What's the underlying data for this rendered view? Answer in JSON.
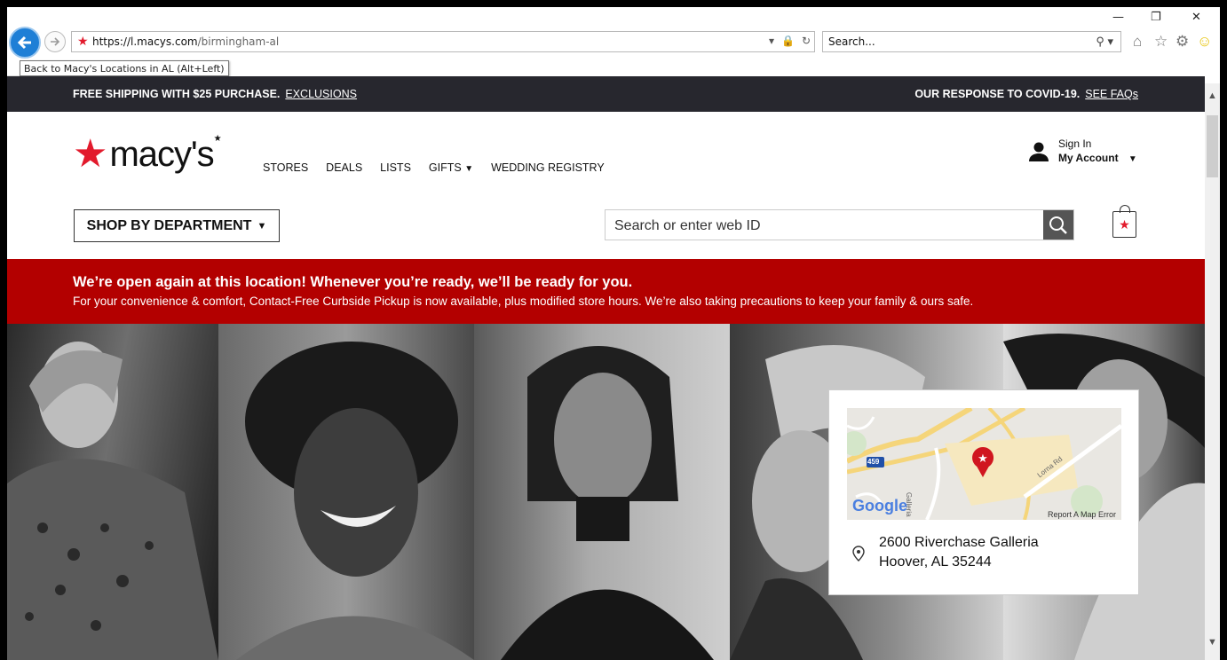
{
  "browser": {
    "url_host": "https://l.macys.com",
    "url_path": "/birmingham-al",
    "search_placeholder": "Search...",
    "tooltip": "Back to Macy's Locations in AL (Alt+Left)"
  },
  "promo": {
    "left_text": "FREE SHIPPING WITH $25 PURCHASE.",
    "left_link": "EXCLUSIONS",
    "right_text": "OUR RESPONSE TO COVID-19.",
    "right_link": "SEE FAQs"
  },
  "header": {
    "logo": "macy's",
    "nav": [
      "STORES",
      "DEALS",
      "LISTS",
      "GIFTS",
      "WEDDING REGISTRY"
    ],
    "sign_in": "Sign In",
    "my_account": "My Account",
    "shop_by_department": "SHOP BY DEPARTMENT",
    "search_placeholder": "Search or enter web ID"
  },
  "banner": {
    "headline": "We’re open again at this location! Whenever you’re ready, we’ll be ready for you.",
    "body": "For your convenience & comfort, Contact-Free Curbside Pickup is now available, plus modified store hours. We’re also taking precautions to keep your family & ours safe."
  },
  "map": {
    "labels": [
      "459",
      "Galleria",
      "Lorna Rd"
    ],
    "google": "Google",
    "report": "Report A Map Error"
  },
  "store": {
    "address_line1": "2600 Riverchase Galleria",
    "address_line2": "Hoover, AL 35244"
  },
  "colors": {
    "brand_red": "#e21a2c",
    "banner_red": "#b30000",
    "promo_bar": "#27272e",
    "browser_back": "#1e7fd6"
  }
}
